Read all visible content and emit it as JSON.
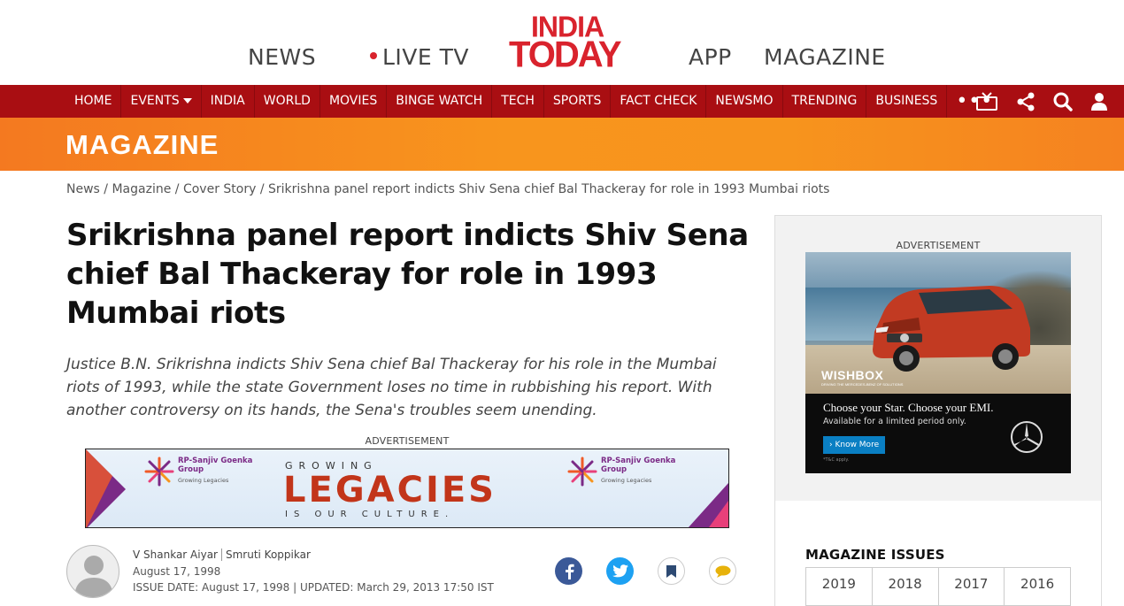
{
  "top": {
    "links": [
      "NEWS",
      "LIVE TV",
      "APP",
      "MAGAZINE"
    ],
    "logo_line1": "INDIA",
    "logo_line2": "TODAY"
  },
  "nav": {
    "items": [
      "HOME",
      "EVENTS",
      "INDIA",
      "WORLD",
      "MOVIES",
      "BINGE WATCH",
      "TECH",
      "SPORTS",
      "FACT CHECK",
      "NEWSMO",
      "TRENDING",
      "BUSINESS"
    ],
    "more": "•••",
    "icons": [
      "tv-icon",
      "share-icon",
      "search-icon",
      "user-icon"
    ]
  },
  "section": {
    "title": "MAGAZINE"
  },
  "breadcrumb": {
    "items": [
      "News",
      "Magazine",
      "Cover Story"
    ],
    "current": "Srikrishna panel report indicts Shiv Sena chief Bal Thackeray for role in 1993 Mumbai riots"
  },
  "article": {
    "headline": "Srikrishna panel report indicts Shiv Sena chief Bal Thackeray for role in 1993 Mumbai riots",
    "summary": "Justice B.N. Srikrishna indicts Shiv Sena chief Bal Thackeray for his role in the Mumbai riots of 1993, while the state Government loses no time in rubbishing his report. With another controversy on its hands, the Sena's troubles seem unending.",
    "authors": [
      "V Shankar Aiyar",
      "Smruti Koppikar"
    ],
    "date": "August 17, 1998",
    "issue_line": "ISSUE DATE: August 17, 1998 | UPDATED: March 29, 2013 17:50 IST"
  },
  "ads": {
    "label": "ADVERTISEMENT",
    "banner": {
      "brand": "RP-Sanjiv Goenka",
      "brand2": "Group",
      "tagline": "Growing Legacies",
      "growing": "GROWING",
      "legacies": "LEGACIES",
      "culture": "IS OUR CULTURE."
    },
    "sidebar": {
      "wishbox": "WISHBOX",
      "wishbox_sub": "DRIVING THE MERCEDES-BENZ OF SOLUTIONS",
      "line1": "Choose your Star. Choose your EMI.",
      "line2": "Available for a limited period only.",
      "button": "› Know More",
      "tnc": "*T&C apply."
    }
  },
  "sidebar": {
    "issues_title": "MAGAZINE ISSUES",
    "years": [
      "2019",
      "2018",
      "2017",
      "2016"
    ]
  },
  "colors": {
    "brand_red": "#d9232d",
    "nav_bg": "#a90e12",
    "section_orange": "#f7941d",
    "facebook": "#3b5998",
    "twitter": "#1da1f2"
  }
}
